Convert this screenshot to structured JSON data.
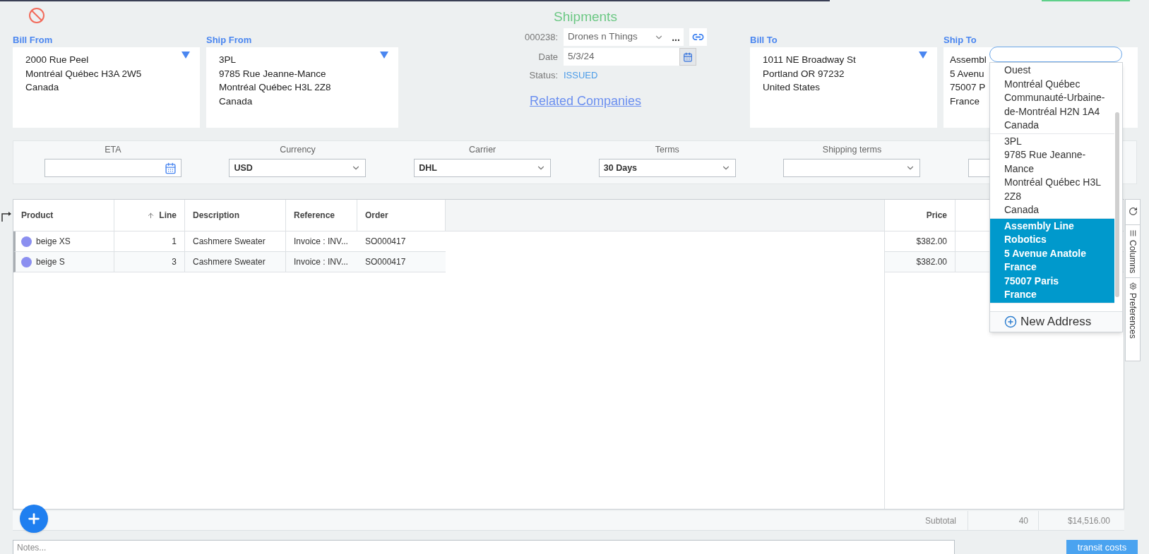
{
  "title": "Shipments",
  "bill_from": {
    "label": "Bill From",
    "lines": [
      "2000 Rue Peel",
      "Montréal Québec H3A 2W5",
      "Canada"
    ]
  },
  "ship_from": {
    "label": "Ship From",
    "lines": [
      "3PL",
      "9785 Rue Jeanne-Mance",
      "Montréal Québec H3L 2Z8",
      "Canada"
    ]
  },
  "header": {
    "number_label": "000238:",
    "company": "Drones n Things",
    "more": "...",
    "date_label": "Date",
    "date": "5/3/24",
    "status_label": "Status:",
    "status": "ISSUED",
    "related_link": "Related Companies"
  },
  "bill_to": {
    "label": "Bill To",
    "lines": [
      "1011 NE Broadway St",
      "Portland OR 97232",
      "United States"
    ]
  },
  "ship_to": {
    "label": "Ship To",
    "lines": [
      "Assembl",
      "5 Avenu",
      "75007 P",
      "France"
    ]
  },
  "fields": [
    {
      "label": "ETA",
      "kind": "date"
    },
    {
      "label": "Currency",
      "kind": "select",
      "value": "USD"
    },
    {
      "label": "Carrier",
      "kind": "select",
      "value": "DHL"
    },
    {
      "label": "Terms",
      "kind": "select",
      "value": "30 Days"
    },
    {
      "label": "Shipping terms",
      "kind": "select"
    },
    {
      "kind": "input"
    }
  ],
  "table": {
    "columns": [
      {
        "label": "Product",
        "sorted": false
      },
      {
        "label": "Line",
        "sorted": true
      },
      {
        "label": "Description",
        "sorted": false
      },
      {
        "label": "Reference",
        "sorted": false
      },
      {
        "label": "Order",
        "sorted": false
      }
    ],
    "right_columns": [
      {
        "label": "Price"
      }
    ],
    "rows": [
      {
        "product": "beige XS",
        "line": "1",
        "description": "Cashmere Sweater",
        "reference": "Invoice : INV...",
        "order": "SO000417",
        "price": "$382.00"
      },
      {
        "product": "beige S",
        "line": "3",
        "description": "Cashmere Sweater",
        "reference": "Invoice : INV...",
        "order": "SO000417",
        "price": "$382.00"
      }
    ],
    "side_tabs": [
      "Columns",
      "Preferences"
    ],
    "subtotal_label": "Subtotal",
    "subtotal_qty": "40",
    "subtotal_amount": "$14,516.00"
  },
  "notes": {
    "placeholder": "Notes..."
  },
  "transit_button": "transit costs",
  "address_dropdown": {
    "options": [
      {
        "lines": [
          "Ouest",
          "Montréal Québec",
          "Communauté-Urbaine-de-Montréal H2N 1A4",
          "Canada"
        ],
        "selected": false
      },
      {
        "lines": [
          "3PL",
          "9785 Rue Jeanne-Mance",
          "Montréal Québec H3L 2Z8",
          "Canada"
        ],
        "selected": false
      },
      {
        "lines": [
          "Assembly Line Robotics",
          "5 Avenue Anatole France",
          "75007 Paris",
          "France"
        ],
        "selected": true
      }
    ],
    "new_address": "New Address"
  }
}
